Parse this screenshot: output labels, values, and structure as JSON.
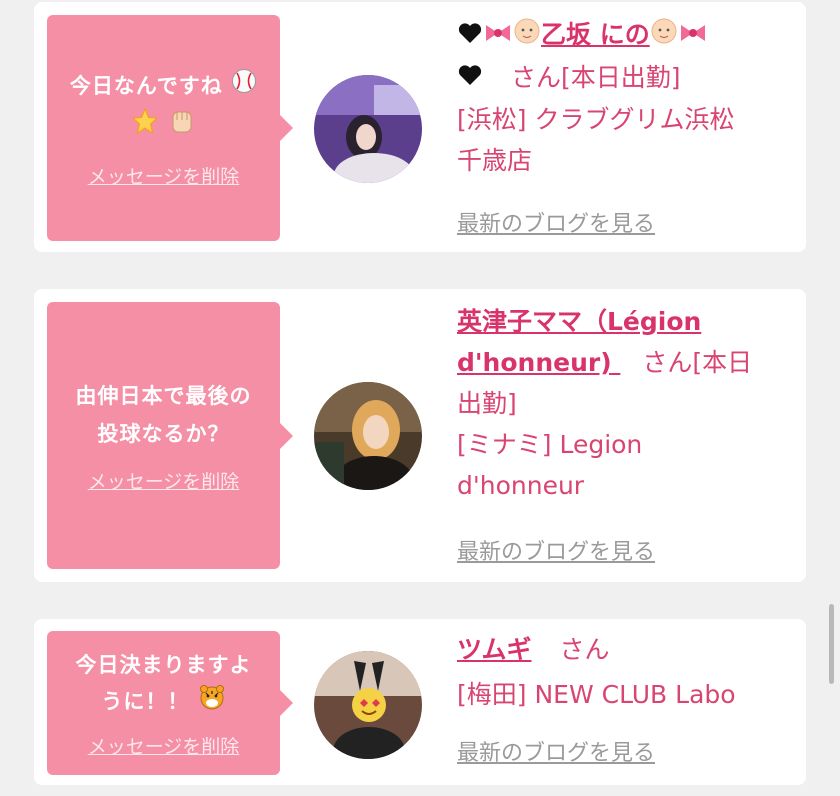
{
  "cards": [
    {
      "message_line1": "今日なんですね",
      "delete_label": "メッセージを削除",
      "name_part1": "乙坂 にの",
      "san_line2_suffix": "さん[本日出勤]",
      "shop_line1": "[浜松] クラブグリム浜松",
      "shop_line2": "千歳店",
      "blog_label": "最新のブログを見る"
    },
    {
      "message_line1": "由伸日本で最後の",
      "message_line2": "投球なるか？",
      "delete_label": "メッセージを削除",
      "name_line1": "英津子ママ（Légion",
      "name_line2": "d'honneur)",
      "san_suffix": "さん[本日",
      "status_line": "出勤]",
      "shop_line1": "[ミナミ] Legion",
      "shop_line2": "d'honneur",
      "blog_label": "最新のブログを見る"
    },
    {
      "message_line1": "今日決まりますよ",
      "message_line2": "うに！！",
      "delete_label": "メッセージを削除",
      "name": "ツムギ",
      "san_suffix": "さん",
      "shop_line1": "[梅田] NEW CLUB Labo",
      "blog_label": "最新のブログを見る"
    }
  ],
  "colors": {
    "bubble": "#f58fa5",
    "name": "#d8336a",
    "info_text": "#d94572",
    "link_gray": "#9a9a9a",
    "background": "#f0f0f0"
  },
  "icons": [
    "baseball-icon",
    "glowing-star-icon",
    "raised-fist-icon",
    "black-heart-icon",
    "ribbon-icon",
    "baby-face-icon",
    "tiger-face-icon"
  ]
}
